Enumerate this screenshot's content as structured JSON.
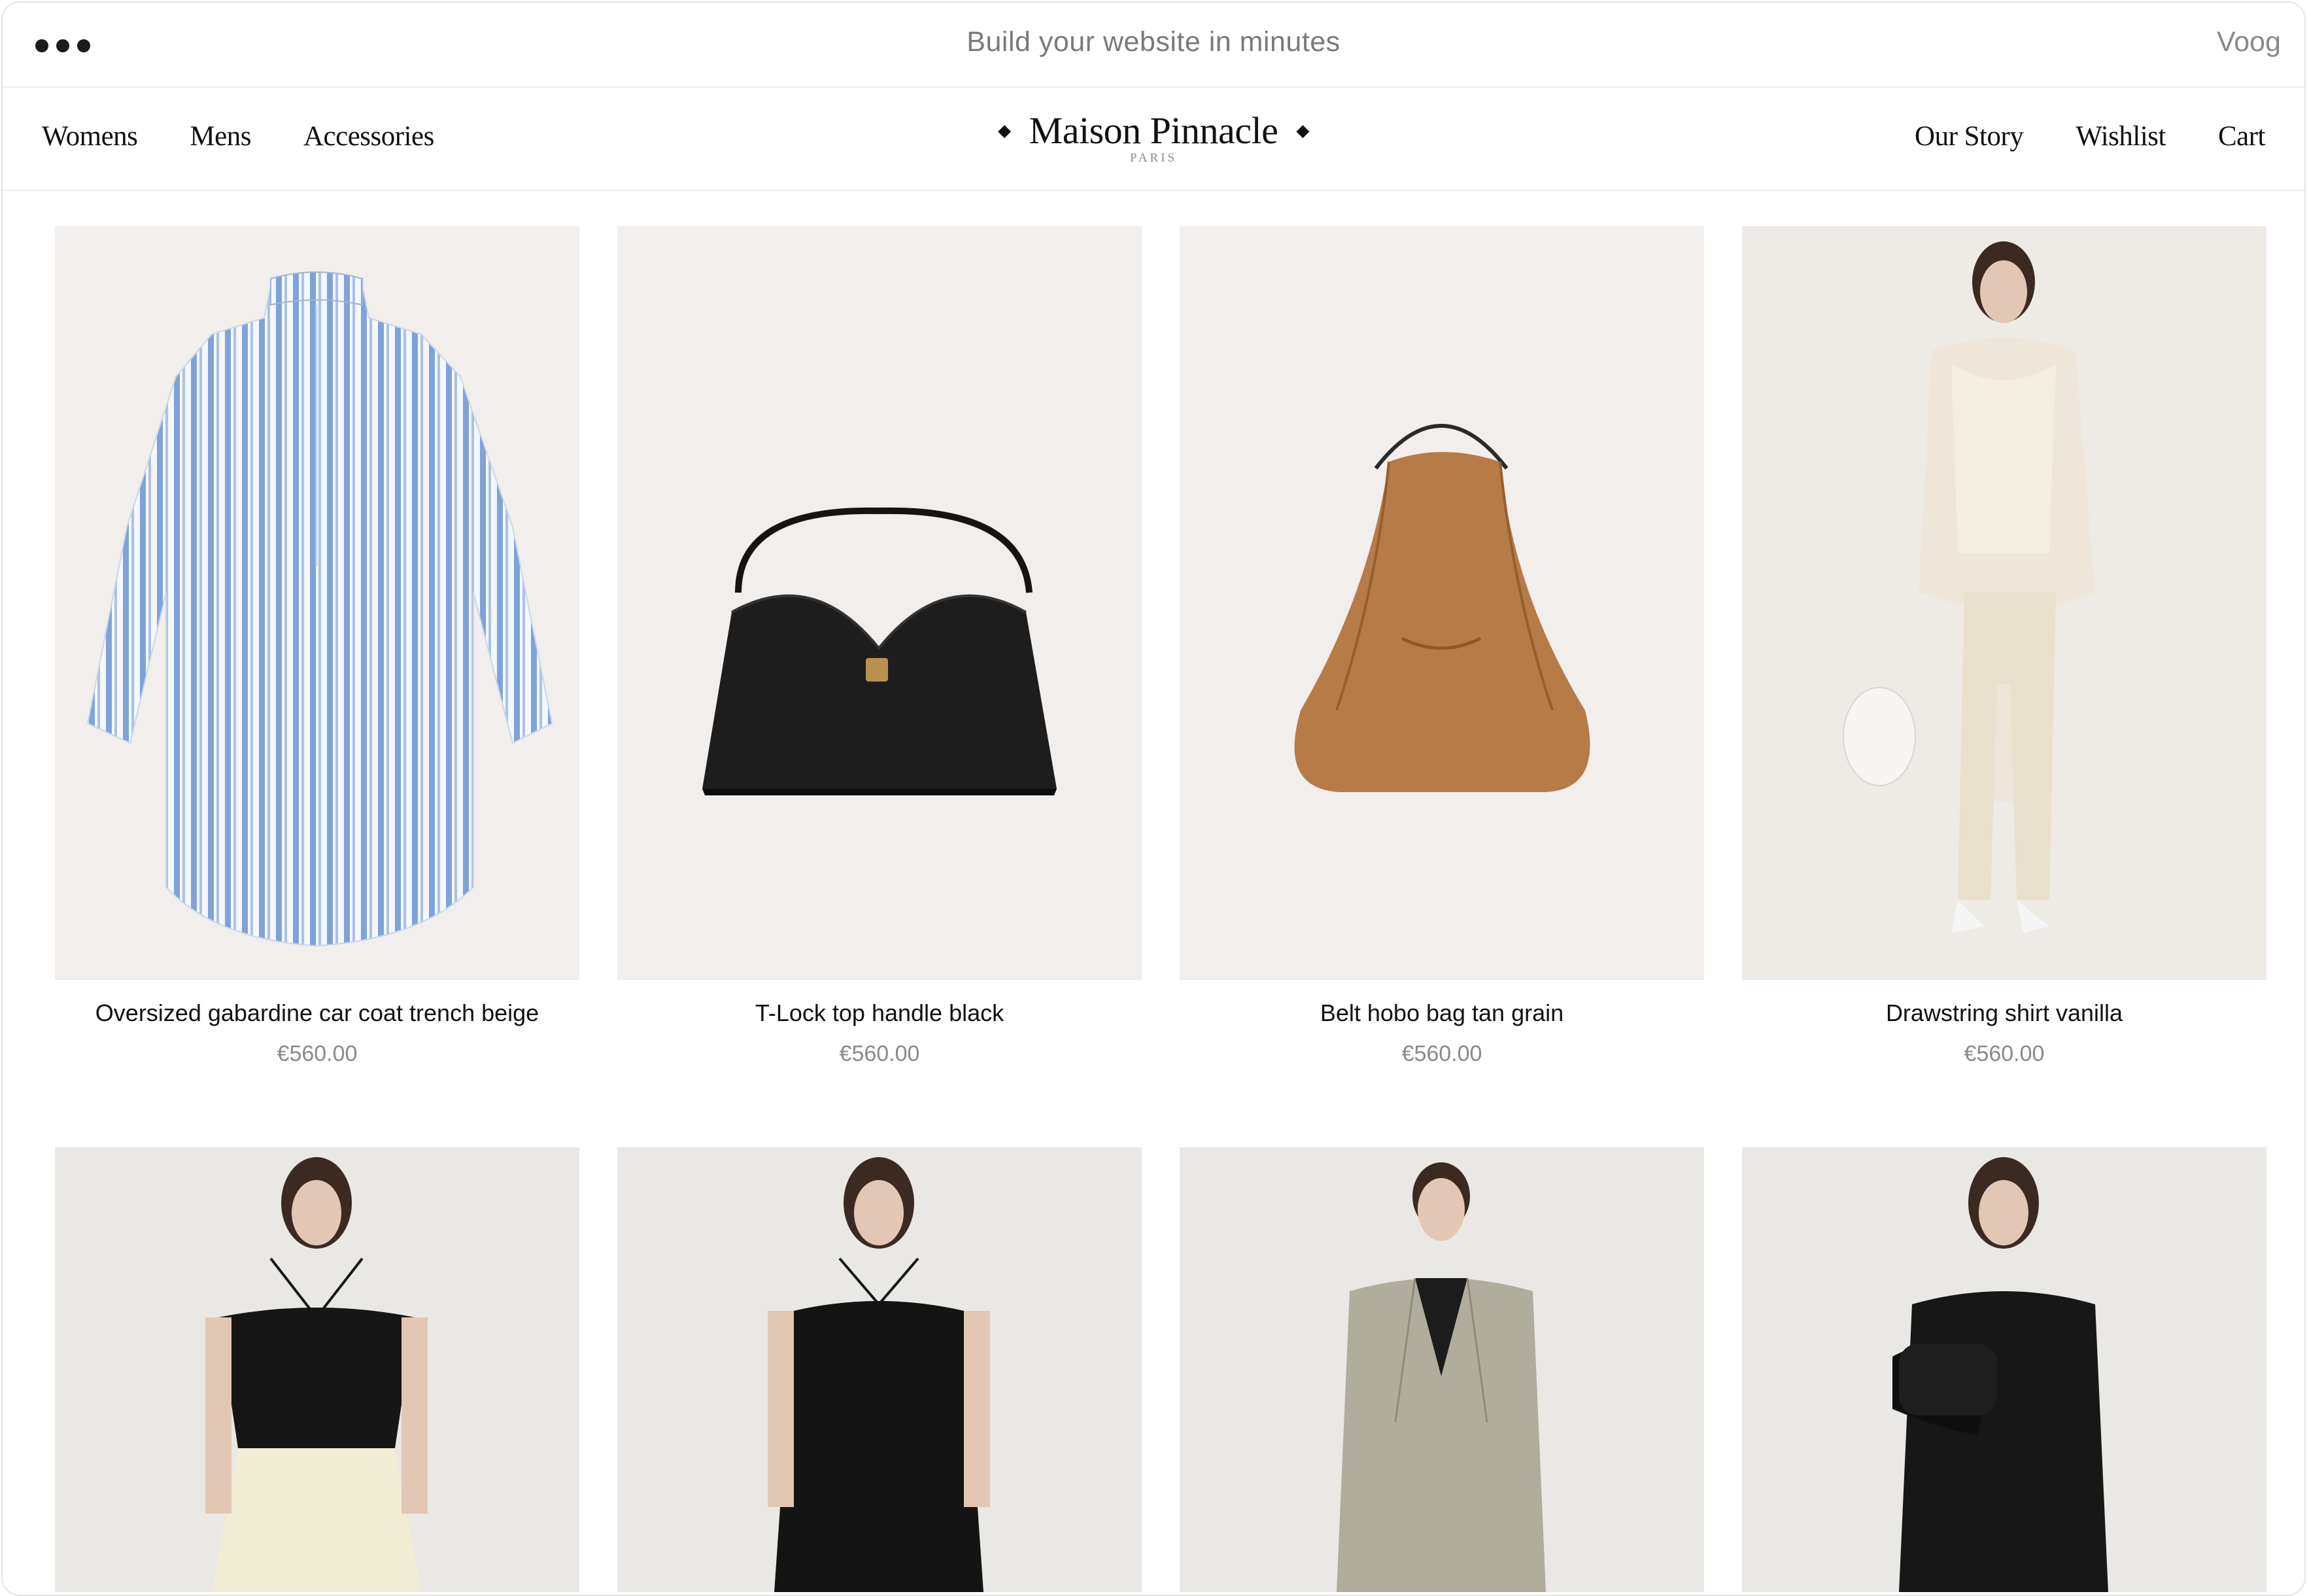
{
  "topbar": {
    "tagline": "Build your website in minutes",
    "vendor": "Voog"
  },
  "nav": {
    "left": [
      "Womens",
      "Mens",
      "Accessories"
    ],
    "right": [
      "Our Story",
      "Wishlist",
      "Cart"
    ],
    "brand": {
      "name": "Maison Pinnacle",
      "subtitle": "PARIS"
    }
  },
  "products": [
    {
      "title": "Oversized gabardine car coat trench beige",
      "price": "€560.00",
      "image": "striped-shirt"
    },
    {
      "title": "T-Lock top handle black",
      "price": "€560.00",
      "image": "black-handbag"
    },
    {
      "title": "Belt hobo bag tan grain",
      "price": "€560.00",
      "image": "tan-hobo-bag"
    },
    {
      "title": "Drawstring shirt vanilla",
      "price": "€560.00",
      "image": "model-cream-outfit"
    }
  ],
  "products_row2": [
    {
      "image": "model-black-top-cream-skirt"
    },
    {
      "image": "model-black-dress"
    },
    {
      "image": "model-grey-blazer"
    },
    {
      "image": "model-black-knit-bag"
    }
  ],
  "colors": {
    "card_bg": "#f1eeec",
    "price": "#8a8a8a",
    "text": "#111111"
  }
}
